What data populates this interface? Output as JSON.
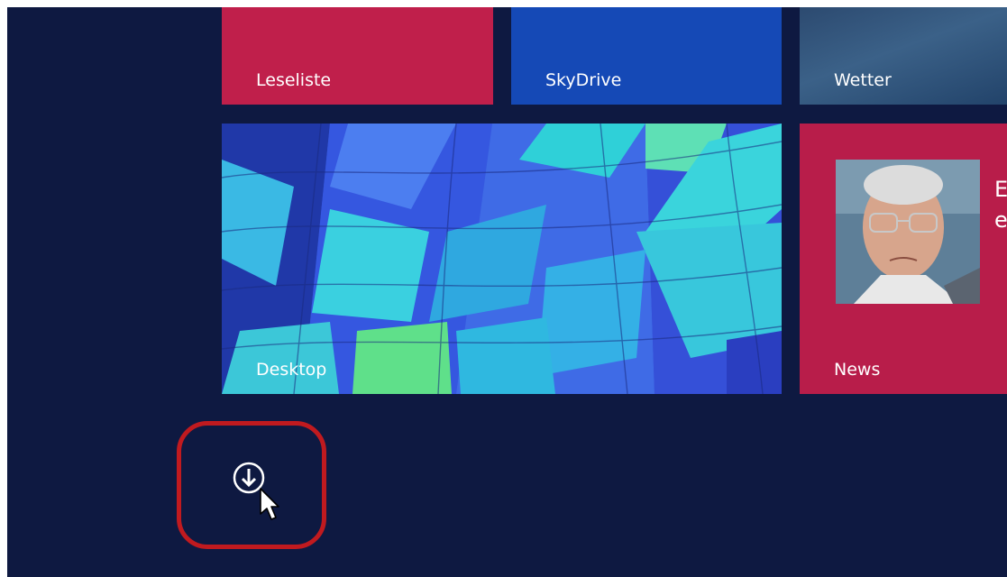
{
  "tiles": {
    "leseliste": {
      "label": "Leseliste",
      "color": "#c01f4b"
    },
    "skydrive": {
      "label": "SkyDrive",
      "color": "#1549b6"
    },
    "wetter": {
      "label": "Wetter"
    },
    "desktop": {
      "label": "Desktop",
      "wallpaper": "hot-air-balloon-pattern"
    },
    "news": {
      "label": "News",
      "color": "#b81d4a",
      "headline_fragment": [
        "E",
        "e"
      ]
    }
  },
  "apps_button": {
    "icon": "down-arrow-circle-icon"
  },
  "annotation": {
    "highlight_color": "#c01a1f"
  },
  "colors": {
    "background": "#0e1941"
  }
}
